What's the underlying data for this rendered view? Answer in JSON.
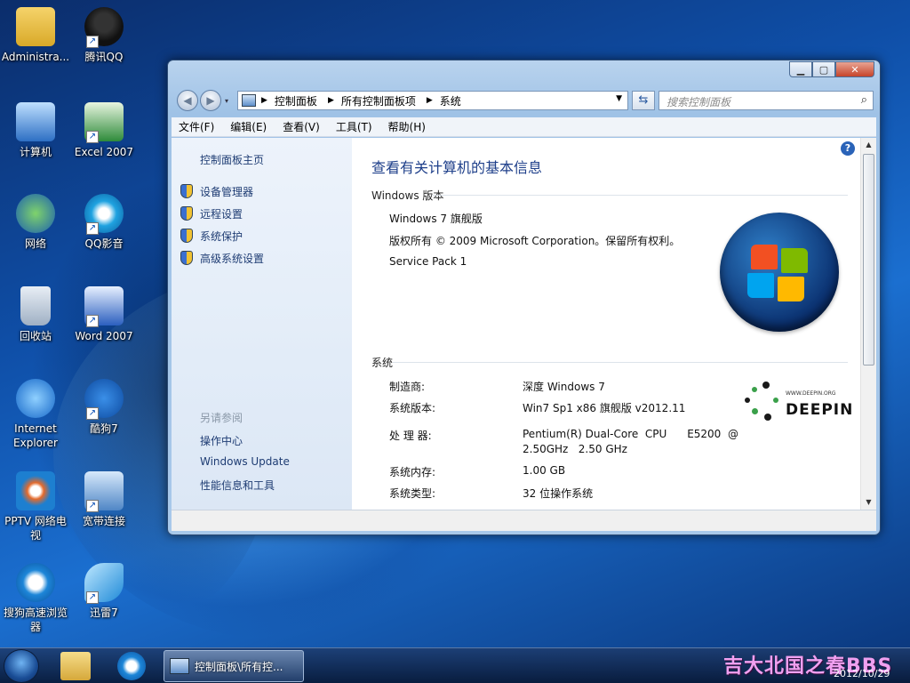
{
  "desktop": {
    "icons": [
      {
        "label": "Administra..."
      },
      {
        "label": "腾讯QQ"
      },
      {
        "label": "计算机"
      },
      {
        "label": "Excel 2007"
      },
      {
        "label": "网络"
      },
      {
        "label": "QQ影音"
      },
      {
        "label": "回收站"
      },
      {
        "label": "Word 2007"
      },
      {
        "label": "Internet Explorer"
      },
      {
        "label": "酷狗7"
      },
      {
        "label": "PPTV 网络电视"
      },
      {
        "label": "宽带连接"
      },
      {
        "label": "搜狗高速浏览器"
      },
      {
        "label": "迅雷7"
      }
    ]
  },
  "window": {
    "address": {
      "seg1": "控制面板",
      "seg2": "所有控制面板项",
      "seg3": "系统"
    },
    "search_placeholder": "搜索控制面板",
    "menu": [
      "文件(F)",
      "编辑(E)",
      "查看(V)",
      "工具(T)",
      "帮助(H)"
    ],
    "left_pane": {
      "home": "控制面板主页",
      "tasks": [
        "设备管理器",
        "远程设置",
        "系统保护",
        "高级系统设置"
      ],
      "see_also_title": "另请参阅",
      "see_also": [
        "操作中心",
        "Windows Update",
        "性能信息和工具"
      ]
    },
    "main": {
      "title": "查看有关计算机的基本信息",
      "edition_header": "Windows 版本",
      "edition": "Windows 7 旗舰版",
      "copyright": "版权所有 © 2009 Microsoft Corporation。保留所有权利。",
      "service_pack": "Service Pack 1",
      "system_header": "系统",
      "rows": [
        {
          "label": "制造商:",
          "value": "深度 Windows 7"
        },
        {
          "label": "系统版本:",
          "value": "Win7 Sp1 x86 旗舰版 v2012.11"
        },
        {
          "label": "处 理 器:",
          "value": "Pentium(R) Dual-Core  CPU      E5200  @",
          "value2": "2.50GHz   2.50 GHz"
        },
        {
          "label": "系统内存:",
          "value": "1.00 GB"
        },
        {
          "label": "系统类型:",
          "value": "32 位操作系统"
        }
      ],
      "oem_logo": {
        "url": "WWW.DEEPIN.ORG",
        "name": "DEEPIN"
      }
    }
  },
  "taskbar": {
    "task_label": "控制面板\\所有控...",
    "watermark": "吉大北国之春BBS",
    "date": "2012/10/29"
  },
  "colors": {
    "accent": "#1e3f8a",
    "link": "#1e3c73",
    "window_frame": "#a8c8ea"
  }
}
